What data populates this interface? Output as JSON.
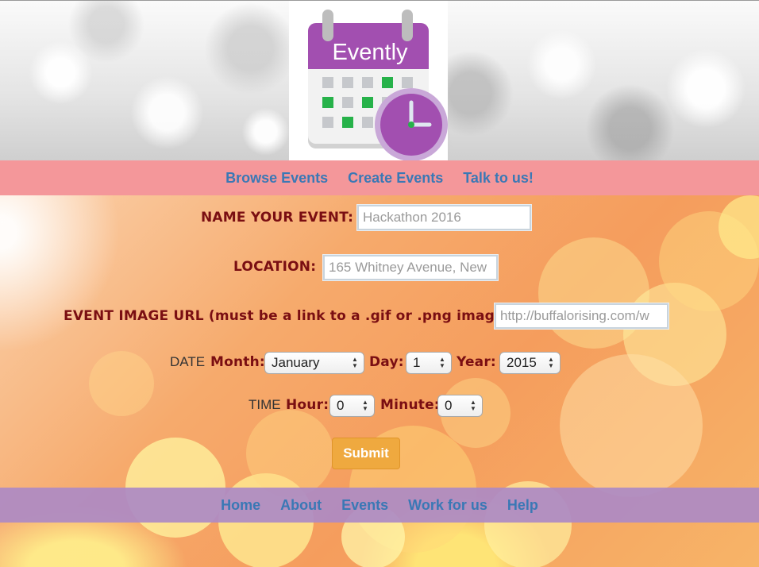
{
  "logo": {
    "text": "Evently",
    "accent": "#a24fb0",
    "green": "#27b24a"
  },
  "top_nav": [
    "Browse Events",
    "Create Events",
    "Talk to us!"
  ],
  "form": {
    "name_label": "NAME YOUR EVENT:",
    "name_placeholder": "Hackathon 2016",
    "location_label": "LOCATION:",
    "location_placeholder": "165 Whitney Avenue, New",
    "image_label": "EVENT IMAGE URL (must be a link to a .gif or .png image):",
    "image_placeholder": "http://buffalorising.com/w",
    "date_prefix": "DATE",
    "month_label": "Month:",
    "month_value": "January",
    "day_label": "Day:",
    "day_value": "1",
    "year_label": "Year:",
    "year_value": "2015",
    "time_prefix": "TIME",
    "hour_label": "Hour:",
    "hour_value": "0",
    "minute_label": "Minute:",
    "minute_value": "0",
    "submit_label": "Submit"
  },
  "bottom_nav": [
    "Home",
    "About",
    "Events",
    "Work for us",
    "Help"
  ],
  "colors": {
    "label": "#7a0e12",
    "link": "#3a78b5",
    "top_nav_bg": "#f4969f",
    "bottom_nav_bg": "#ac8ac4",
    "submit_bg": "#efa93f"
  }
}
